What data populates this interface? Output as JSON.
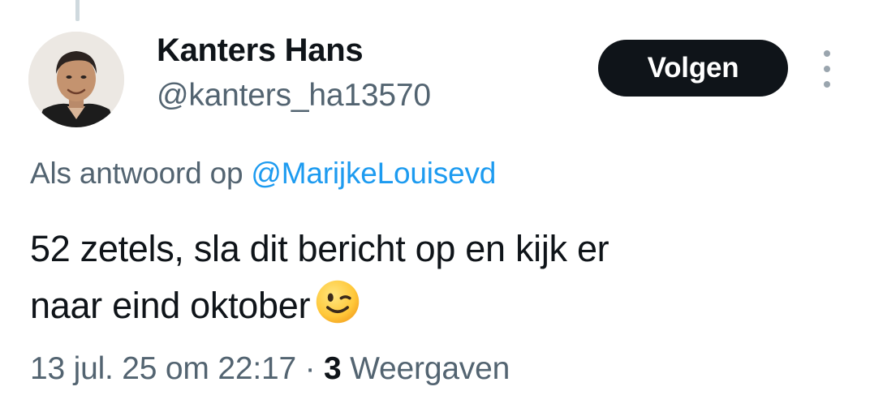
{
  "author": {
    "display_name": "Kanters Hans",
    "handle": "@kanters_ha13570"
  },
  "actions": {
    "follow_label": "Volgen"
  },
  "reply": {
    "prefix": "Als antwoord op",
    "mention": "@MarijkeLouisevd"
  },
  "tweet": {
    "line1": "52 zetels, sla dit bericht op en kijk er",
    "line2": "naar eind oktober",
    "emoji": "winking-face"
  },
  "meta": {
    "timestamp": "13 jul. 25 om 22:17",
    "separator": "·",
    "views_count": "3",
    "views_label": "Weergaven"
  },
  "colors": {
    "text": "#0f1419",
    "secondary": "#536471",
    "link": "#1d9bf0",
    "follow_bg": "#0f1419"
  }
}
